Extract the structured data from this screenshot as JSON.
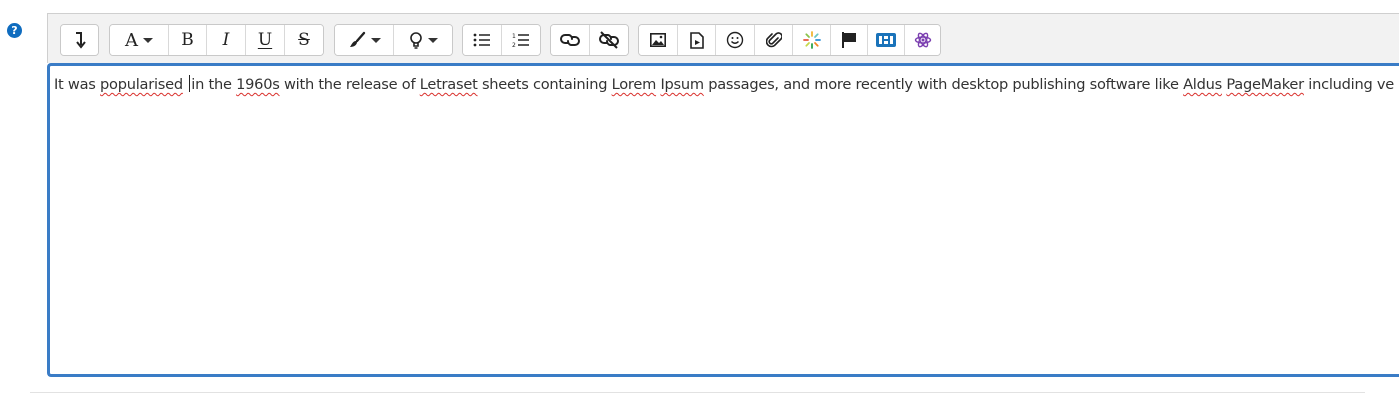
{
  "help": {
    "label": "?"
  },
  "toolbar": {
    "groups": [
      {
        "buttons": [
          "collapse-icon"
        ]
      },
      {
        "buttons": [
          "font-color-icon",
          "bold-icon",
          "italic-icon",
          "underline-icon",
          "strikethrough-icon"
        ]
      },
      {
        "buttons": [
          "brush-icon",
          "lightbulb-icon"
        ]
      },
      {
        "buttons": [
          "unordered-list-icon",
          "ordered-list-icon"
        ]
      },
      {
        "buttons": [
          "link-icon",
          "unlink-icon"
        ]
      },
      {
        "buttons": [
          "image-icon",
          "media-icon",
          "emoji-icon",
          "attachment-icon",
          "loading-icon",
          "flag-icon",
          "h5p-icon",
          "atom-icon"
        ]
      }
    ],
    "font_letter": "A",
    "bold_letter": "B",
    "italic_letter": "I",
    "underline_letter": "U",
    "strike_letter": "S"
  },
  "editor": {
    "segments": [
      {
        "text": "It was ",
        "misspelled": false
      },
      {
        "text": "popularised",
        "misspelled": true
      },
      {
        "text": " ",
        "misspelled": false,
        "cursor_after": true
      },
      {
        "text": "in the ",
        "misspelled": false
      },
      {
        "text": "1960s",
        "misspelled": true
      },
      {
        "text": " with the release of ",
        "misspelled": false
      },
      {
        "text": "Letraset",
        "misspelled": true
      },
      {
        "text": " sheets containing ",
        "misspelled": false
      },
      {
        "text": "Lorem",
        "misspelled": true
      },
      {
        "text": " ",
        "misspelled": false
      },
      {
        "text": "Ipsum",
        "misspelled": true
      },
      {
        "text": " passages, and more recently with desktop publishing software like ",
        "misspelled": false
      },
      {
        "text": "Aldus",
        "misspelled": true
      },
      {
        "text": " ",
        "misspelled": false
      },
      {
        "text": "PageMaker",
        "misspelled": true
      },
      {
        "text": " including ve",
        "misspelled": false
      }
    ]
  },
  "colors": {
    "focus_border": "#3a7cc6",
    "help_icon": "#0f6cbf",
    "spell_underline": "#d9302c",
    "toolbar_bg": "#f2f2f2"
  }
}
